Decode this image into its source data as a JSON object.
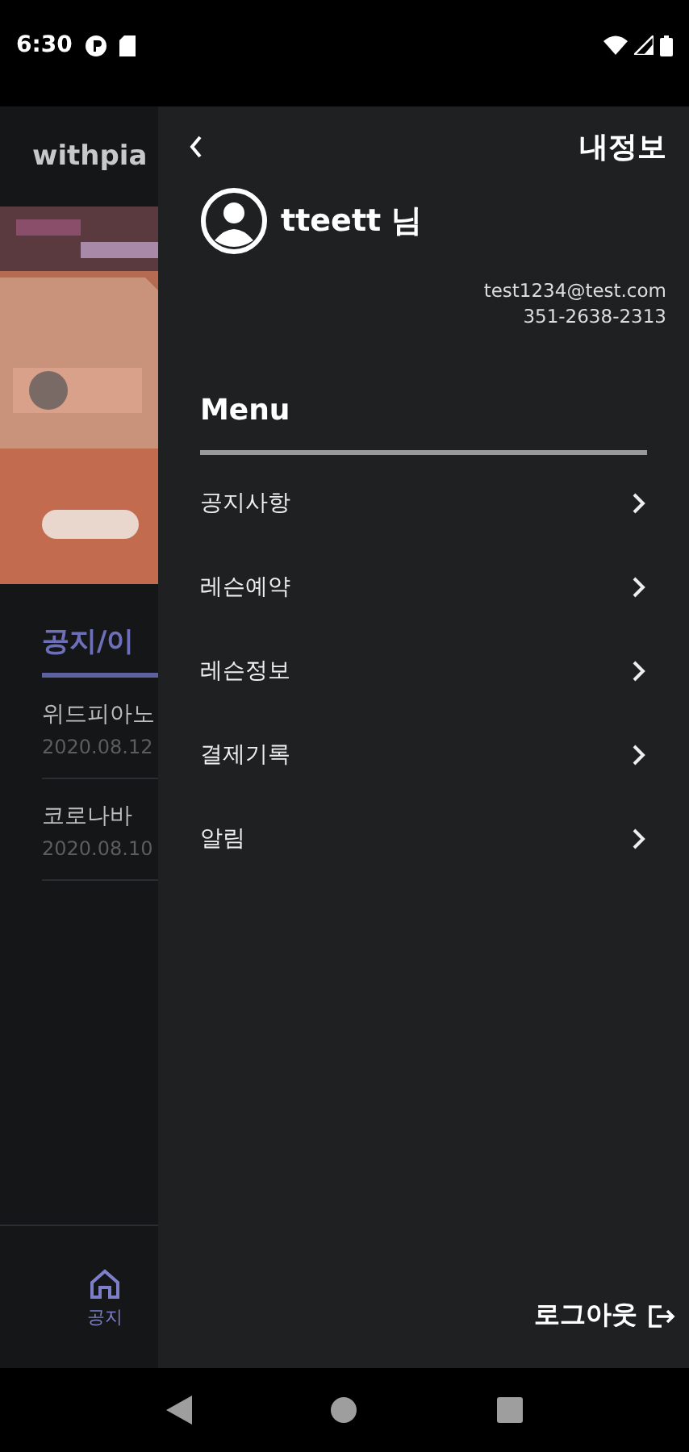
{
  "status_bar": {
    "time": "6:30"
  },
  "background_screen": {
    "app_title": "withpia",
    "tab": {
      "label": "공지/이",
      "selected": true
    },
    "notices": [
      {
        "title": "위드피아노",
        "date": "2020.08.12"
      },
      {
        "title": "코로나바",
        "date": "2020.08.10"
      }
    ],
    "bottom_nav": [
      {
        "label": "공지",
        "selected": true
      }
    ]
  },
  "drawer": {
    "title": "내정보",
    "user": {
      "name": "tteett 님",
      "email": "test1234@test.com",
      "phone": "351-2638-2313"
    },
    "menu_heading": "Menu",
    "items": [
      {
        "label": "공지사항"
      },
      {
        "label": "레슨예약"
      },
      {
        "label": "레슨정보"
      },
      {
        "label": "결제기록"
      },
      {
        "label": "알림"
      }
    ],
    "logout": "로그아웃"
  }
}
